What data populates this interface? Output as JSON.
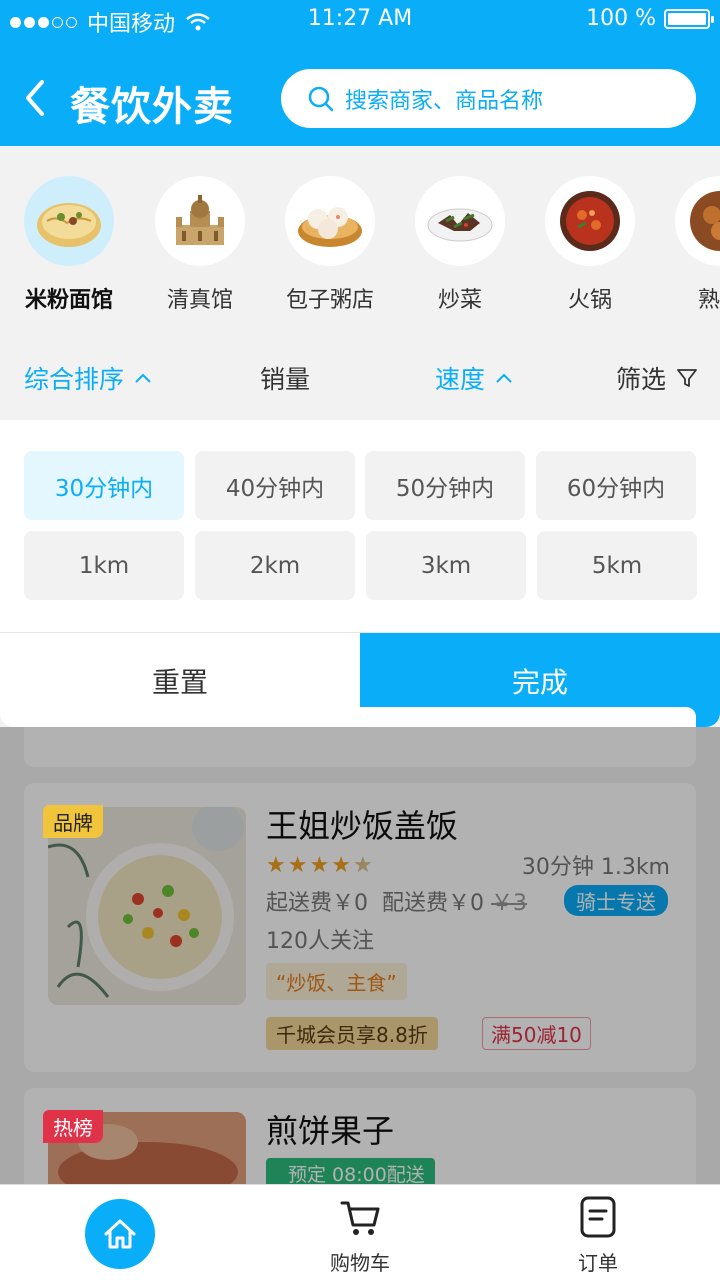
{
  "status_bar": {
    "carrier": "中国移动",
    "time": "11:27 AM",
    "battery": "100 %"
  },
  "header": {
    "title": "餐饮外卖",
    "search_placeholder": "搜索商家、商品名称"
  },
  "categories": [
    {
      "label": "米粉面馆",
      "icon": "noodle-icon",
      "active": true
    },
    {
      "label": "清真馆",
      "icon": "mosque-icon",
      "active": false
    },
    {
      "label": "包子粥店",
      "icon": "bun-icon",
      "active": false
    },
    {
      "label": "炒菜",
      "icon": "stir-fry-icon",
      "active": false
    },
    {
      "label": "火锅",
      "icon": "hotpot-icon",
      "active": false
    },
    {
      "label": "熟食",
      "icon": "deli-icon",
      "active": false
    }
  ],
  "sort_bar": {
    "overall": "综合排序",
    "sales": "销量",
    "speed": "速度",
    "filter": "筛选"
  },
  "filter_panel": {
    "time_options": [
      "30分钟内",
      "40分钟内",
      "50分钟内",
      "60分钟内"
    ],
    "distance_options": [
      "1km",
      "2km",
      "3km",
      "5km"
    ],
    "selected_time": "30分钟内",
    "reset_label": "重置",
    "done_label": "完成"
  },
  "shops": [
    {
      "tag": "品牌",
      "name": "王姐炒饭盖饭",
      "rating": 4.5,
      "time_distance": "30分钟 1.3km",
      "min_order": "起送费￥0",
      "delivery_fee": "配送费￥0",
      "delivery_fee_original": "￥3",
      "rider_badge": "骑士专送",
      "followers": "120人关注",
      "keywords": "“炒饭、主食”",
      "vip_offer": "千城会员享8.8折",
      "promo": "满50减10"
    },
    {
      "tag": "热榜",
      "name": "煎饼果子",
      "preorder": "预定  08:00配送"
    }
  ],
  "tab_bar": {
    "home": "",
    "cart": "购物车",
    "orders": "订单"
  },
  "colors": {
    "primary": "#0aadf8",
    "brand_tag": "#f0c53c",
    "hot_tag": "#e0334a"
  }
}
